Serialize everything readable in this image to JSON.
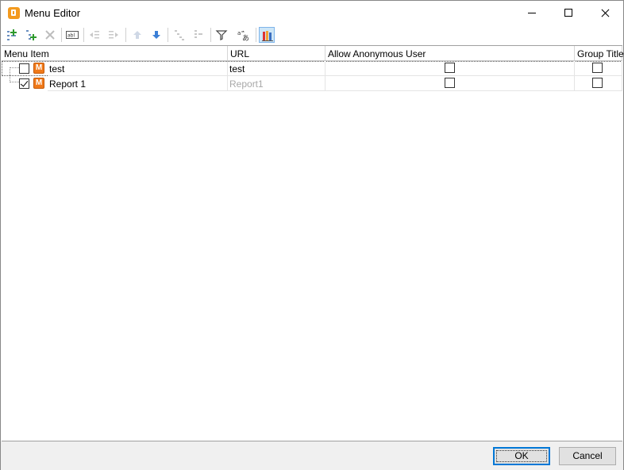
{
  "window": {
    "title": "Menu Editor"
  },
  "toolbar": {
    "buttons": [
      {
        "icon": "add-item-icon",
        "enabled": true
      },
      {
        "icon": "add-child-item-icon",
        "enabled": true
      },
      {
        "icon": "delete-icon",
        "enabled": false
      },
      {
        "icon": "rename-icon",
        "enabled": true
      },
      {
        "icon": "outdent-icon",
        "enabled": false
      },
      {
        "icon": "indent-icon",
        "enabled": false
      },
      {
        "icon": "move-up-icon",
        "enabled": false
      },
      {
        "icon": "move-down-icon",
        "enabled": true
      },
      {
        "icon": "expand-all-icon",
        "enabled": false
      },
      {
        "icon": "collapse-all-icon",
        "enabled": false
      },
      {
        "icon": "filter-icon",
        "enabled": true
      },
      {
        "icon": "translate-icon",
        "enabled": true
      },
      {
        "icon": "reports-icon",
        "enabled": true,
        "active": true
      }
    ]
  },
  "grid": {
    "columns": [
      "Menu Item",
      "URL",
      "Allow Anonymous User",
      "Group Title"
    ],
    "rows": [
      {
        "name": "test",
        "url": "test",
        "visible": false,
        "allow_anonymous": false,
        "group_title": false
      },
      {
        "name": "Report 1",
        "url": "Report1",
        "visible": true,
        "allow_anonymous": false,
        "group_title": false
      }
    ]
  },
  "footer": {
    "ok_label": "OK",
    "cancel_label": "Cancel"
  }
}
